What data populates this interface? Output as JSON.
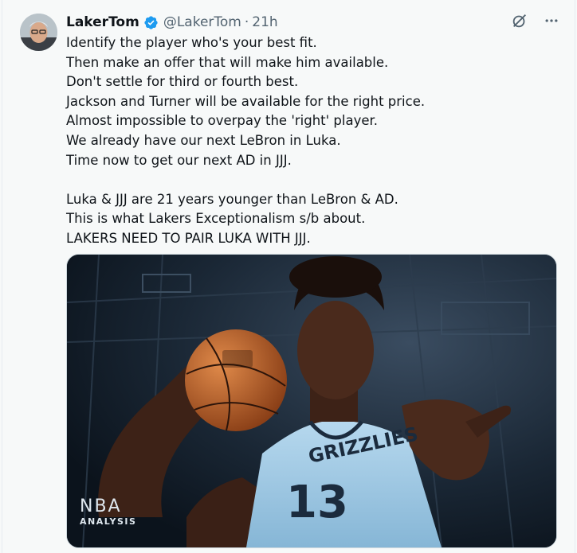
{
  "tweet": {
    "display_name": "LakerTom",
    "handle": "@LakerTom",
    "separator": "·",
    "time": "21h",
    "lines": [
      "Identify the player who's your best fit.",
      "Then make an offer that will make him available.",
      "Don't settle for third or fourth best.",
      "Jackson and Turner will be available for the right price.",
      "Almost impossible to overpay the 'right' player.",
      "We already have our next LeBron in Luka.",
      "Time now to get our next AD in JJJ.",
      "",
      "Luka & JJJ are 21 years younger than LeBron & AD.",
      "This is what Lakers Exceptionalism s/b about.",
      "LAKERS NEED TO PAIR LUKA WITH JJJ."
    ]
  },
  "media": {
    "watermark_line1": "NBA",
    "watermark_line2": "ANALYSIS",
    "jersey_team": "GRIZZLIES",
    "jersey_number": "13"
  },
  "icons": {
    "verified": "verified-badge-icon",
    "grok": "grok-icon",
    "more": "more-icon"
  },
  "colors": {
    "verified_blue": "#1d9bf0",
    "secondary_text": "#536471",
    "jersey": "#9ec8e3"
  }
}
